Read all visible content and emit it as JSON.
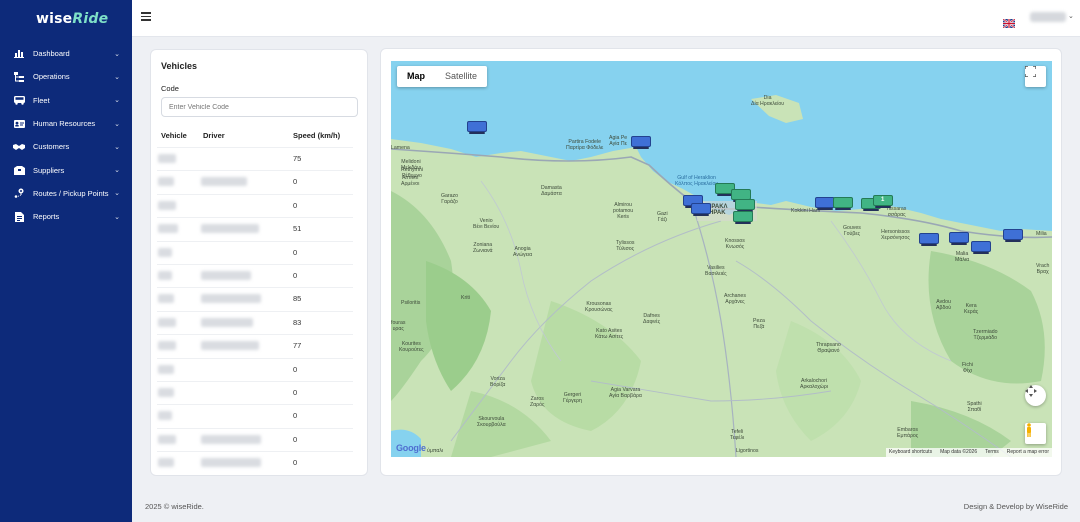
{
  "brand": {
    "prefix": "wise",
    "suffix": "Ride",
    "accent": "#7ee0c8"
  },
  "colors": {
    "sidebar": "#0d2a7a",
    "marker_blue": "#3f70d6",
    "marker_green": "#41b484"
  },
  "sidebar": {
    "items": [
      {
        "label": "Dashboard",
        "icon": "chart-icon"
      },
      {
        "label": "Operations",
        "icon": "operations-icon"
      },
      {
        "label": "Fleet",
        "icon": "bus-icon"
      },
      {
        "label": "Human Resources",
        "icon": "id-card-icon"
      },
      {
        "label": "Customers",
        "icon": "handshake-icon"
      },
      {
        "label": "Suppliers",
        "icon": "box-icon"
      },
      {
        "label": "Routes / Pickup Points",
        "icon": "route-icon"
      },
      {
        "label": "Reports",
        "icon": "report-icon"
      }
    ]
  },
  "topbar": {
    "language_icon": "uk-flag-icon"
  },
  "vehicles": {
    "title": "Vehicles",
    "code_label": "Code",
    "code_placeholder": "Enter Vehicle Code",
    "code_value": "",
    "headers": {
      "vehicle": "Vehicle",
      "driver": "Driver",
      "speed": "Speed (km/h)"
    },
    "speeds": [
      "75",
      "0",
      "0",
      "51",
      "0",
      "0",
      "85",
      "83",
      "77",
      "0",
      "0",
      "0",
      "0",
      "0"
    ]
  },
  "map": {
    "type_map": "Map",
    "type_satellite": "Satellite",
    "google": "Google",
    "attribution": {
      "shortcuts": "Keyboard shortcuts",
      "data": "Map data ©2026",
      "terms": "Terms",
      "report": "Report a map error"
    },
    "labels": {
      "dia_heraklion": "Dia\nΔία Ηρακλείου",
      "lamena": "Lamena",
      "partira": "Partira Fodele\nΠαρτίρα Φόδελε",
      "agia_pelagia": "Agia Pe\nΑγία Πε",
      "meliodoni": "Melidoni\nΜελιδόνι",
      "rethymno": "Rethymni\nΡέθυμνο",
      "armeni": "Armeni\nΑρμένοι",
      "gulf": "Gulf of Heraklion\nΚόλπος Ηρακλείου",
      "damasta": "Damasta\nΔαμάστα",
      "garazo": "Garazo\nΓαράζο",
      "almirou": "Almirou\npotamou\nKeris",
      "gazi": "Gazi\nΓάζι",
      "kokkini": "Kokkini Hani",
      "gouves": "Gouves\nΓούβες",
      "hersonissos": "Hersonissos\nΧερσόνησος",
      "nissaras": "nissaras\nσσάρας",
      "venio": "Venio\nΒένι Βενίου",
      "zoniana": "Zoniana\nΖωνιανά",
      "anogia": "Anogia\nΑνώγεια",
      "tylissos": "Tylissos\nΤύλισος",
      "knossos": "Knossos\nΚνωσός",
      "malia": "Malia\nΜάλια",
      "milia": "Milia",
      "vrachasi": "Vrach\nΒραχ",
      "vasilies": "Vasilies\nΒασιλειές",
      "psiloritis": "Psiloritis",
      "kriti": "Kriti",
      "krousonas": "Krousonas\nΚρουσώνας",
      "avdou": "Avdou\nΑβδού",
      "kera": "Kera\nΚεράς",
      "fouras": "fouras\nυρας",
      "dafnes": "Dafnes\nΔαφνές",
      "archanes": "Archanes\nΑρχάνες",
      "peza": "Peza\nΠεζά",
      "kato_asites": "Kato Asites\nΚάτω Ασίτες",
      "kourites": "Kourites\nΚουρούτες",
      "tzermiado": "Tzermiado\nΤζερμιάδο",
      "thrapsano": "Thrapsano\nΘραψανό",
      "voriza": "Voriza\nΒορίζα",
      "zaros": "Zaros\nΖαρός",
      "gergeri": "Gergeri\nΓέργερη",
      "agia_varvara": "Agia Varvara\nΑγία Βαρβάρα",
      "arkalochori": "Arkalochori\nΑρκαλοχώρι",
      "fichi": "Fichi\nΦίχι",
      "spathi": "Spathi\nΣπαθί",
      "skourvoula": "Skourvoula\nΣκουρβούλα",
      "tefeli": "Tefeli\nΤεφέλι",
      "ligortinos": "Ligortinos",
      "embaros": "Embaros\nΕμπάρος",
      "rimpali": "ύμπαλι",
      "irakleio": "ΗΡΑΚΛ\nΗΡΑΚ"
    },
    "cluster_count": "1"
  },
  "footer": {
    "left": "2025 © wiseRide.",
    "right": "Design & Develop by WiseRide"
  }
}
